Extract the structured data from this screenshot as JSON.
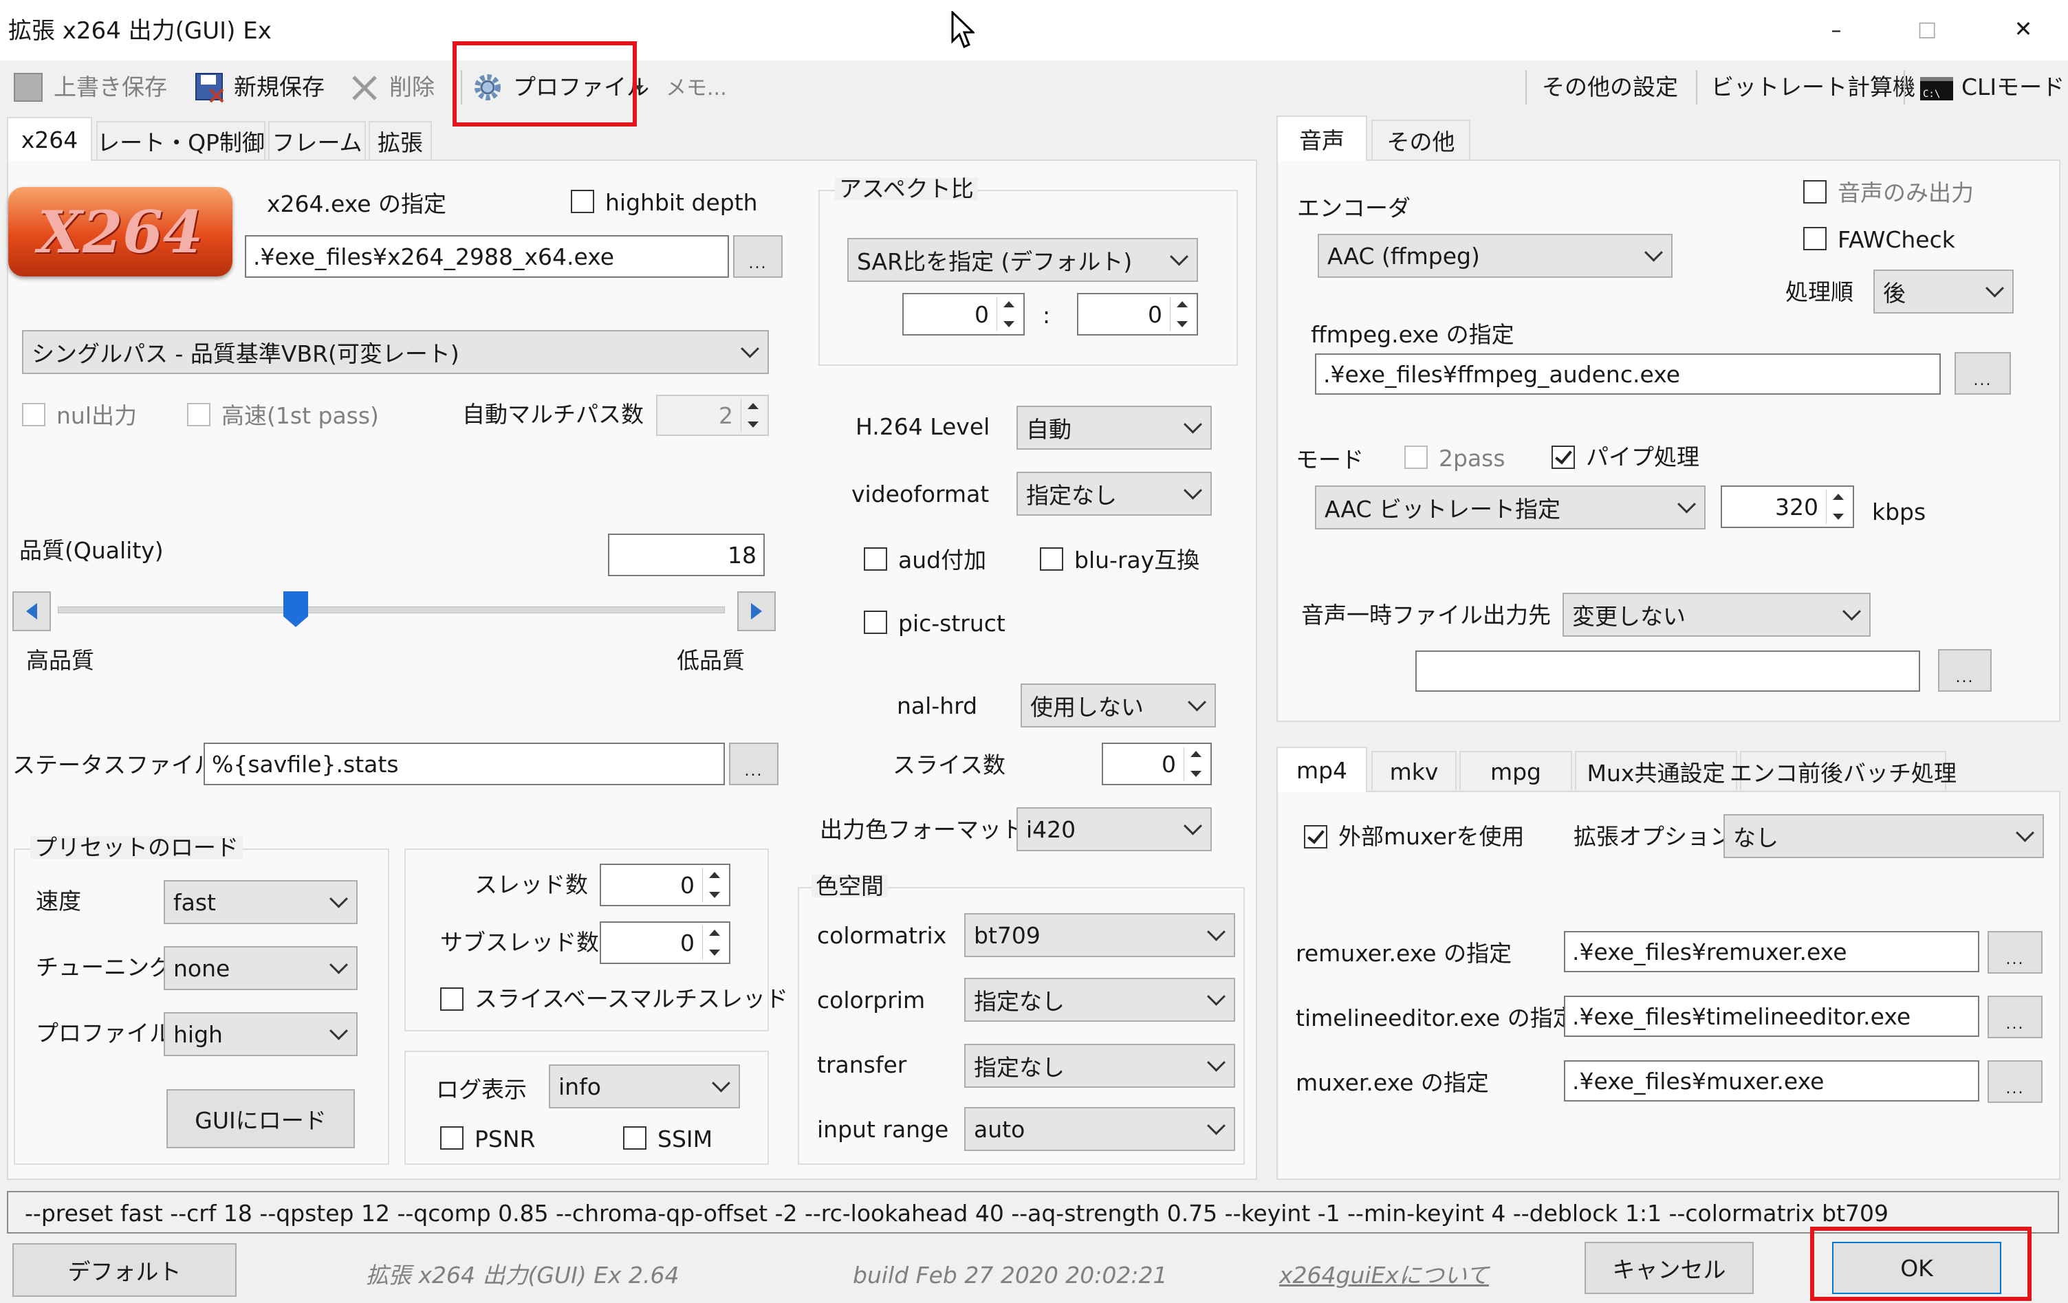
{
  "window": {
    "title": "拡張 x264 出力(GUI) Ex",
    "min": "–",
    "max": "□",
    "close": "✕"
  },
  "toolbar": {
    "overwrite_save": "上書き保存",
    "new_save": "新規保存",
    "delete": "削除",
    "profile": "プロファイル",
    "memo": "メモ...",
    "other_settings": "その他の設定",
    "bitrate_calc": "ビットレート計算機",
    "cli_mode": "CLIモード"
  },
  "left_tabs": [
    "x264",
    "レート・QP制御",
    "フレーム",
    "拡張"
  ],
  "x264": {
    "logo_text": "X264",
    "exe_label": "x264.exe の指定",
    "highbit_label": "highbit depth",
    "exe_path": ".¥exe_files¥x264_2988_x64.exe",
    "browse": "...",
    "mode": "シングルパス - 品質基準VBR(可変レート)",
    "nul_label": "nul出力",
    "fast_label": "高速(1st pass)",
    "multipass_label": "自動マルチパス数",
    "multipass_value": "2",
    "quality_label": "品質(Quality)",
    "quality_value": "18",
    "slider_left": "高品質",
    "slider_right": "低品質",
    "stats_label": "ステータスファイル",
    "stats_value": "%{savfile}.stats",
    "preset_group": "プリセットのロード",
    "speed_label": "速度",
    "speed_value": "fast",
    "tuning_label": "チューニング",
    "tuning_value": "none",
    "profile_label": "プロファイル",
    "profile_value": "high",
    "load_button": "GUIにロード",
    "thread_label": "スレッド数",
    "thread_value": "0",
    "subthread_label": "サブスレッド数",
    "subthread_value": "0",
    "slice_mt_label": "スライスベースマルチスレッド",
    "log_label": "ログ表示",
    "log_value": "info",
    "psnr_label": "PSNR",
    "ssim_label": "SSIM"
  },
  "middle": {
    "aspect_group": "アスペクト比",
    "aspect_mode": "SAR比を指定 (デフォルト)",
    "aspect_x": "0",
    "aspect_colon": ":",
    "aspect_y": "0",
    "level_label": "H.264 Level",
    "level_value": "自動",
    "videoformat_label": "videoformat",
    "videoformat_value": "指定なし",
    "aud_label": "aud付加",
    "bluray_label": "blu-ray互換",
    "picstruct_label": "pic-struct",
    "nalhrd_label": "nal-hrd",
    "nalhrd_value": "使用しない",
    "slices_label": "スライス数",
    "slices_value": "0",
    "color_format_label": "出力色フォーマット",
    "color_format_value": "i420",
    "colorspace_group": "色空間",
    "colormatrix_label": "colormatrix",
    "colormatrix_value": "bt709",
    "colorprim_label": "colorprim",
    "colorprim_value": "指定なし",
    "transfer_label": "transfer",
    "transfer_value": "指定なし",
    "inputrange_label": "input range",
    "inputrange_value": "auto"
  },
  "audio": {
    "tabs": [
      "音声",
      "その他"
    ],
    "encoder_label": "エンコーダ",
    "encoder_value": "AAC (ffmpeg)",
    "audio_only_label": "音声のみ出力",
    "fawcheck_label": "FAWCheck",
    "order_label": "処理順",
    "order_value": "後",
    "ffmpeg_label": "ffmpeg.exe の指定",
    "ffmpeg_path": ".¥exe_files¥ffmpeg_audenc.exe",
    "mode_label": "モード",
    "twopass_label": "2pass",
    "pipe_label": "パイプ処理",
    "mode_value": "AAC ビットレート指定",
    "bitrate_value": "320",
    "bitrate_unit": "kbps",
    "temp_label": "音声一時ファイル出力先",
    "temp_value": "変更しない",
    "temp_path": ""
  },
  "mux": {
    "tabs": [
      "mp4",
      "mkv",
      "mpg",
      "Mux共通設定",
      "エンコ前後バッチ処理"
    ],
    "ext_muxer_label": "外部muxerを使用",
    "ext_opt_label": "拡張オプション",
    "ext_opt_value": "なし",
    "remuxer_label": "remuxer.exe の指定",
    "remuxer_path": ".¥exe_files¥remuxer.exe",
    "timeline_label": "timelineeditor.exe の指定",
    "timeline_path": ".¥exe_files¥timelineeditor.exe",
    "muxer_label": "muxer.exe の指定",
    "muxer_path": ".¥exe_files¥muxer.exe"
  },
  "cmdline": "--preset fast --crf 18 --qpstep 12 --qcomp 0.85 --chroma-qp-offset -2 --rc-lookahead 40 --aq-strength 0.75 --keyint -1 --min-keyint 4 --deblock 1:1 --colormatrix bt709",
  "footer": {
    "default_button": "デフォルト",
    "version": "拡張 x264 出力(GUI) Ex 2.64",
    "build": "build Feb 27 2020 20:02:21",
    "about": "x264guiExについて",
    "cancel": "キャンセル",
    "ok": "OK"
  },
  "colors": {
    "highlight": "#e4141b",
    "accent": "#1e6fd9",
    "logo": "#e34a1a"
  }
}
